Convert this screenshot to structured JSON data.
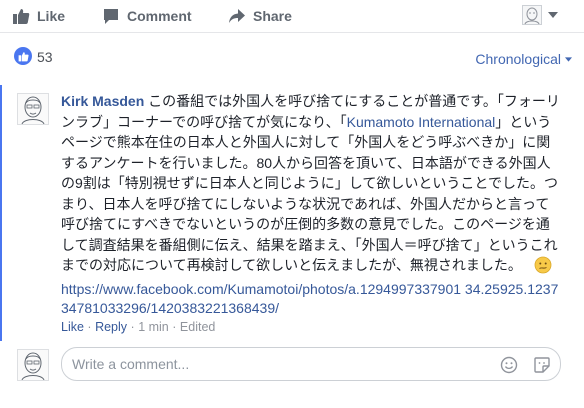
{
  "actions": {
    "like_label": "Like",
    "comment_label": "Comment",
    "share_label": "Share"
  },
  "summary": {
    "like_count": "53",
    "order_label": "Chronological"
  },
  "comment": {
    "author": "Kirk Masden",
    "text_part1": "この番組では外国人を呼び捨てにすることが普通です。「フォーリンラブ」コーナーでの呼び捨てが気になり、「",
    "inline_link": "Kumamoto International",
    "text_part2": "」というページで熊本在住の日本人と外国人に対して「外国人をどう呼ぶべきか」に関するアンケートを行いました。80人から回答を頂いて、日本語ができる外国人の9割は「特別視せずに日本人と同じように」して欲しいということでした。つまり、日本人を呼び捨てにしないような状況であれば、外国人だからと言って呼び捨てにすべきでないというのが圧倒的多数の意見でした。このページを通して調査結果を番組側に伝え、結果を踏まえ、「外国人＝呼び捨て」というこれまでの対応について再検討して欲しいと伝えましたが、無視されました。",
    "url": "https://www.facebook.com/Kumamotoi/photos/a.1294997337901 34.25925.123734781033296/1420383221368439/",
    "like_action": "Like",
    "sep1": "·",
    "reply_action": "Reply",
    "sep2": "·",
    "time": "1 min",
    "sep3": "·",
    "edited": "Edited",
    "emoji": "confused-face-emoji"
  },
  "composer": {
    "placeholder": "Write a comment..."
  },
  "icons": {
    "like": "thumbs-up-icon",
    "comment": "speech-bubble-icon",
    "share": "share-arrow-icon",
    "viewer_avatar": "avatar-icon",
    "caret": "caret-down-icon",
    "emoji_button": "smiley-icon",
    "sticker_button": "sticker-icon"
  },
  "colors": {
    "link": "#365899",
    "accent": "#4a76f0",
    "muted": "#90949c",
    "action": "#606770"
  }
}
